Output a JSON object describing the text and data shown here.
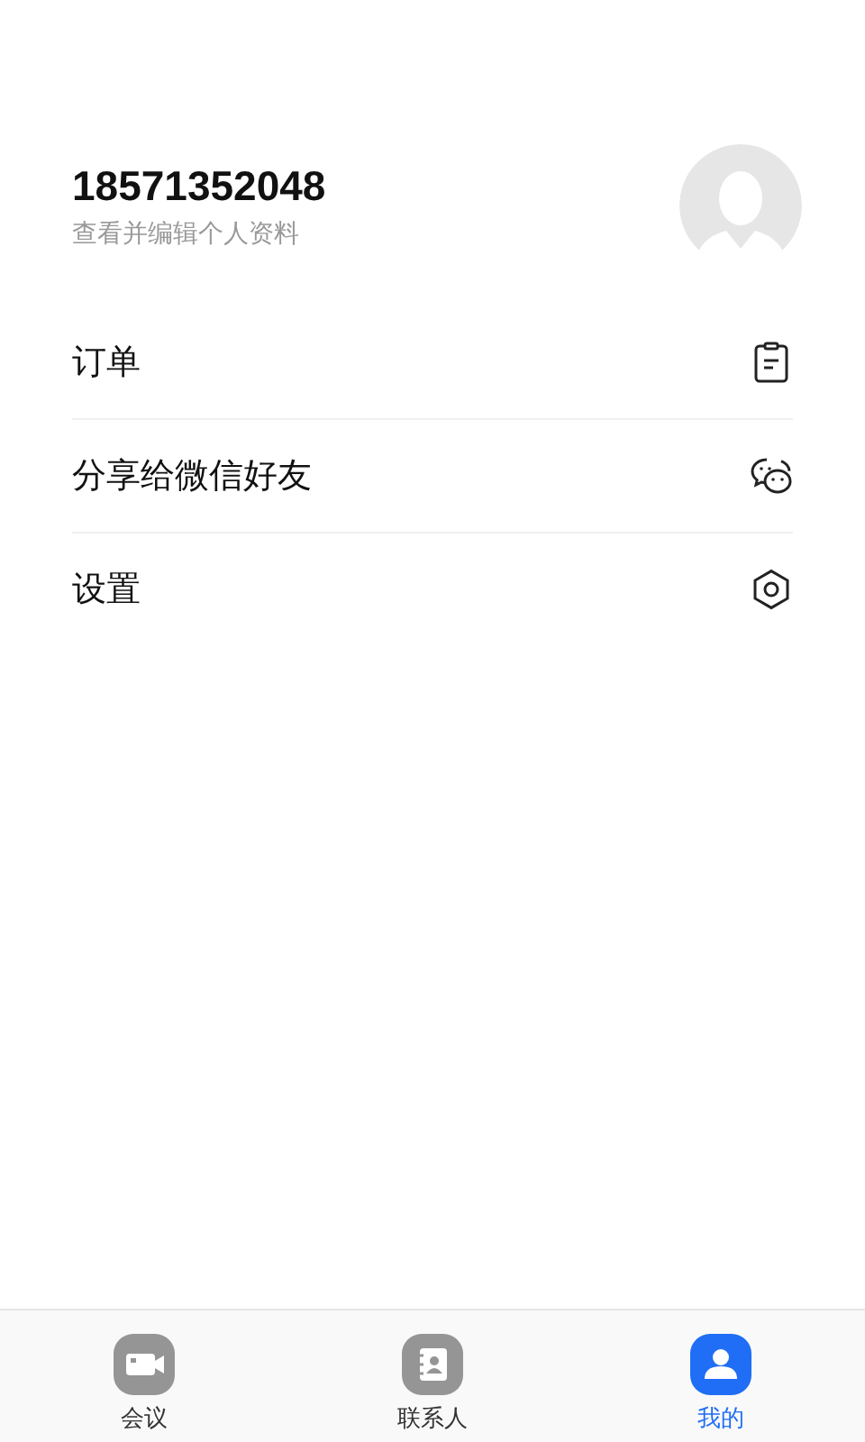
{
  "profile": {
    "phone": "18571352048",
    "subtitle": "查看并编辑个人资料"
  },
  "menu": [
    {
      "label": "订单",
      "kind": "order"
    },
    {
      "label": "分享给微信好友",
      "kind": "chat"
    },
    {
      "label": "设置",
      "kind": "settings"
    }
  ],
  "tabs": [
    {
      "label": "会议",
      "kind": "meeting",
      "selected": false
    },
    {
      "label": "联系人",
      "kind": "contacts",
      "selected": false
    },
    {
      "label": "我的",
      "kind": "me",
      "selected": true
    }
  ]
}
